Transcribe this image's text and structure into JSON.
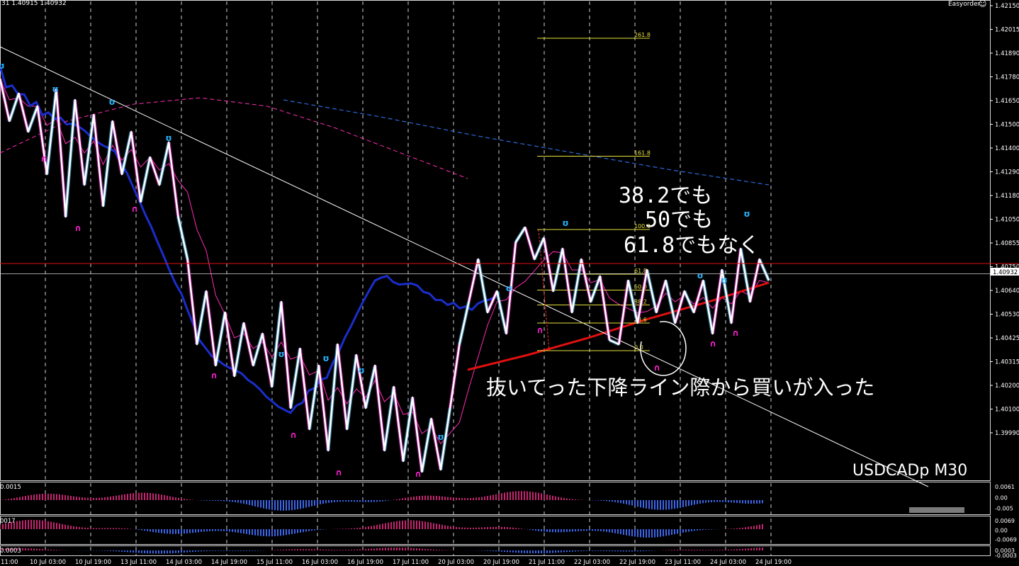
{
  "header": {
    "ohlc_text": "31 1.40915 1.40932",
    "broker": "Easyorder",
    "smiley": "☺"
  },
  "symbol_label": "USDCADp M30",
  "current_price": "1.40932",
  "red_line_price": 1.4098,
  "annotations": {
    "fib_question": [
      "38.2でも",
      "50でも",
      "61.8でもなく"
    ],
    "entry_note": "抜いてった下降ライン際から買いが入った"
  },
  "colors": {
    "background": "#000000",
    "price_line": "#ffffff",
    "ma_fast": "#00b4ff",
    "ma_slow": "#1a2ecc",
    "ma_mid": "#ff2db4",
    "ma_red": "#e01010",
    "ma_long": "#2a6bdc",
    "fib": "#e6e03c",
    "macd_blue": "#3c64e6",
    "macd_pink": "#c2266e",
    "arrow_up": "#28b4ff",
    "arrow_down": "#ff1ed2"
  },
  "chart_data": {
    "type": "line",
    "symbol": "USDCADp",
    "timeframe": "M30",
    "y_axis": [
      "1.42150",
      "1.42015",
      "1.41890",
      "1.41780",
      "1.41650",
      "1.41500",
      "1.41400",
      "1.41290",
      "1.41180",
      "1.41050",
      "1.40855",
      "1.40750",
      "1.40640",
      "1.40530",
      "1.40425",
      "1.40315",
      "1.40200",
      "1.40100",
      "1.39990"
    ],
    "x_axis": [
      "11:00",
      "10 Jul 03:00",
      "10 Jul 19:00",
      "13 Jul 11:00",
      "14 Jul 03:00",
      "14 Jul 19:00",
      "15 Jul 11:00",
      "16 Jul 03:00",
      "16 Jul 19:00",
      "17 Jul 11:00",
      "20 Jul 03:00",
      "20 Jul 19:00",
      "21 Jul 11:00",
      "22 Jul 03:00",
      "22 Jul 19:00",
      "23 Jul 11:00",
      "24 Jul 03:00",
      "24 Jul 19:00"
    ],
    "ylim": [
      1.3996,
      1.4222
    ],
    "price_series": [
      1.4185,
      1.4165,
      1.4178,
      1.416,
      1.4172,
      1.414,
      1.418,
      1.412,
      1.4175,
      1.4135,
      1.4168,
      1.4125,
      1.4165,
      1.414,
      1.416,
      1.4127,
      1.4148,
      1.4135,
      1.4155,
      1.412,
      1.41,
      1.406,
      1.4085,
      1.405,
      1.4075,
      1.4045,
      1.407,
      1.405,
      1.4065,
      1.404,
      1.408,
      1.403,
      1.4058,
      1.402,
      1.405,
      1.401,
      1.406,
      1.402,
      1.4055,
      1.403,
      1.405,
      1.401,
      1.404,
      1.4005,
      1.4035,
      1.4,
      1.4025,
      1.4001,
      1.403,
      1.406,
      1.408,
      1.41,
      1.4075,
      1.4085,
      1.4065,
      1.4108,
      1.4115,
      1.41,
      1.411,
      1.4085,
      1.4105,
      1.4075,
      1.41,
      1.408,
      1.4092,
      1.4062,
      1.406,
      1.409,
      1.407,
      1.4095,
      1.4075,
      1.409,
      1.407,
      1.4085,
      1.4075,
      1.409,
      1.4065,
      1.4095,
      1.407,
      1.4105,
      1.408,
      1.41,
      1.409
    ],
    "fib_levels": [
      {
        "label": "261.8",
        "price": 1.4204
      },
      {
        "label": "161.8",
        "price": 1.41485
      },
      {
        "label": "100.0",
        "price": 1.4114
      },
      {
        "label": "61.8",
        "price": 1.4093
      },
      {
        "label": "50.0",
        "price": 1.40855
      },
      {
        "label": "38.2",
        "price": 1.40785
      },
      {
        "label": "23.6",
        "price": 1.407
      },
      {
        "label": "0.0",
        "price": 1.4057
      }
    ],
    "sub_panels": [
      {
        "label": "0.0015",
        "ticks": [
          "0.0061",
          "0.00",
          "-0.005"
        ]
      },
      {
        "label": "0017",
        "ticks": [
          "0.0069",
          "0.00",
          "-0.0069"
        ]
      },
      {
        "label": "0.0003",
        "ticks": [
          "0.0003",
          "-0.0003"
        ]
      }
    ]
  }
}
